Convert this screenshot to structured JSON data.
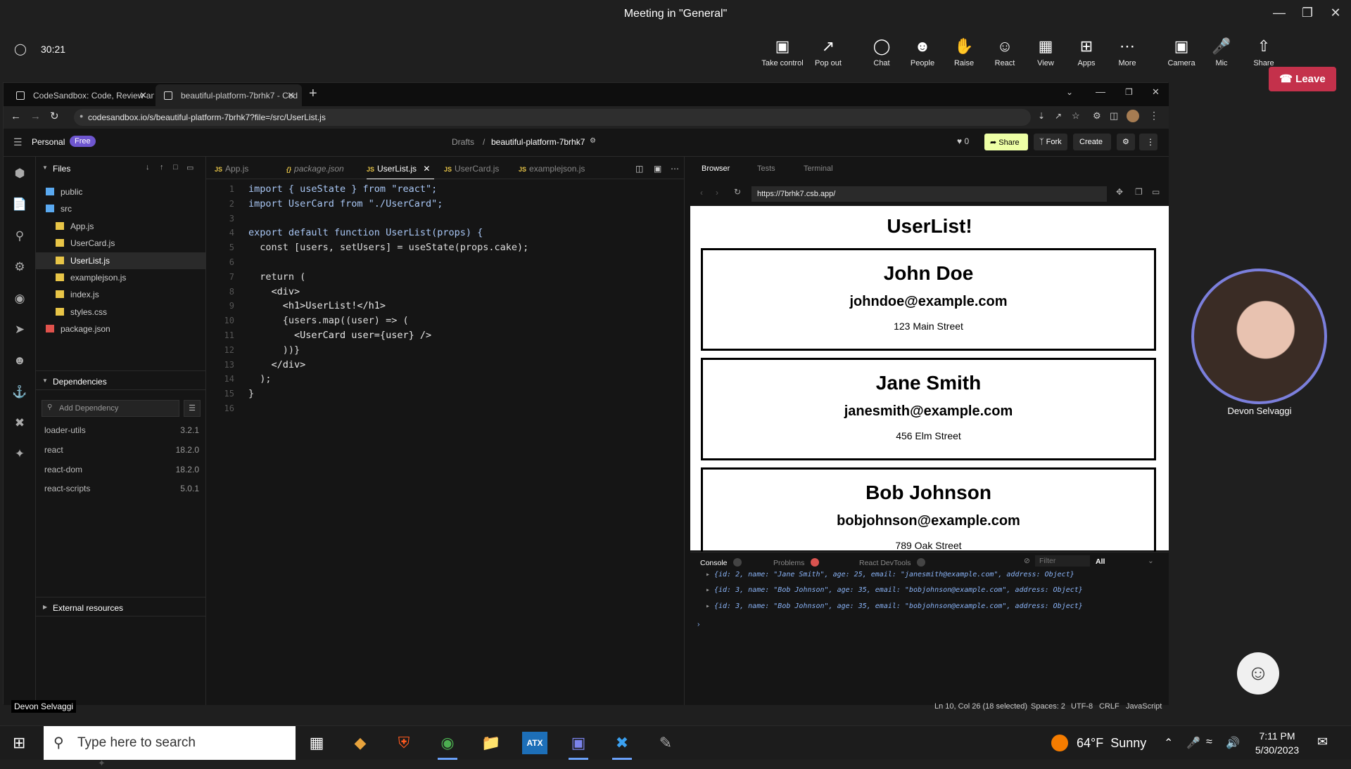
{
  "teams": {
    "title": "Meeting in \"General\"",
    "timer": "30:21",
    "buttons": [
      {
        "icon": "take-control-icon",
        "label": "Take control"
      },
      {
        "icon": "pop-out-icon",
        "label": "Pop out"
      },
      {
        "icon": "chat-icon",
        "label": "Chat"
      },
      {
        "icon": "people-icon",
        "label": "People"
      },
      {
        "icon": "raise-hand-icon",
        "label": "Raise"
      },
      {
        "icon": "react-icon",
        "label": "React"
      },
      {
        "icon": "view-icon",
        "label": "View"
      },
      {
        "icon": "apps-icon",
        "label": "Apps"
      },
      {
        "icon": "more-icon",
        "label": "More"
      },
      {
        "icon": "camera-icon",
        "label": "Camera"
      },
      {
        "icon": "mic-icon",
        "label": "Mic"
      },
      {
        "icon": "share-icon",
        "label": "Share"
      }
    ],
    "leave": "Leave",
    "participant_name": "Devon Selvaggi",
    "presenter_label": "Devon Selvaggi"
  },
  "browser": {
    "tabs": [
      {
        "label": "CodeSandbox: Code, Review and"
      },
      {
        "label": "beautiful-platform-7brhk7 - Cod"
      }
    ],
    "url": "codesandbox.io/s/beautiful-platform-7brhk7?file=/src/UserList.js"
  },
  "csb": {
    "workspace": "Personal",
    "plan": "Free",
    "breadcrumb_parent": "Drafts",
    "breadcrumb_sep": "/",
    "project": "beautiful-platform-7brhk7",
    "likes": "0",
    "share": "Share",
    "fork": "Fork",
    "create": "Create",
    "files_header": "Files",
    "files": [
      {
        "name": "public",
        "type": "folder",
        "indent": 0
      },
      {
        "name": "src",
        "type": "folder",
        "indent": 0
      },
      {
        "name": "App.js",
        "type": "js",
        "indent": 1
      },
      {
        "name": "UserCard.js",
        "type": "js",
        "indent": 1
      },
      {
        "name": "UserList.js",
        "type": "js",
        "indent": 1,
        "active": true
      },
      {
        "name": "examplejson.js",
        "type": "js",
        "indent": 1
      },
      {
        "name": "index.js",
        "type": "js",
        "indent": 1
      },
      {
        "name": "styles.css",
        "type": "css",
        "indent": 1
      },
      {
        "name": "package.json",
        "type": "json",
        "indent": 0
      }
    ],
    "dependencies_header": "Dependencies",
    "add_dependency": "Add Dependency",
    "dependencies": [
      {
        "name": "loader-utils",
        "version": "3.2.1"
      },
      {
        "name": "react",
        "version": "18.2.0"
      },
      {
        "name": "react-dom",
        "version": "18.2.0"
      },
      {
        "name": "react-scripts",
        "version": "5.0.1"
      }
    ],
    "external_resources": "External resources",
    "editor_tabs": [
      "App.js",
      "package.json",
      "UserList.js",
      "UserCard.js",
      "examplejson.js"
    ],
    "code_lines": [
      "import { useState } from \"react\";",
      "import UserCard from \"./UserCard\";",
      "",
      "export default function UserList(props) {",
      "  const [users, setUsers] = useState(props.cake);",
      "",
      "  return (",
      "    <div>",
      "      <h1>UserList!</h1>",
      "      {users.map((user) => (",
      "        <UserCard user={user} />",
      "      ))}",
      "    </div>",
      "  );",
      "}",
      ""
    ],
    "preview_tabs": [
      "Browser",
      "Tests",
      "Terminal"
    ],
    "preview_url": "https://7brhk7.csb.app/",
    "preview_heading": "UserList!",
    "users": [
      {
        "name": "John Doe",
        "email": "johndoe@example.com",
        "address": "123 Main Street"
      },
      {
        "name": "Jane Smith",
        "email": "janesmith@example.com",
        "address": "456 Elm Street"
      },
      {
        "name": "Bob Johnson",
        "email": "bobjohnson@example.com",
        "address": "789 Oak Street"
      }
    ],
    "console_tabs": [
      "Console",
      "Problems",
      "React DevTools"
    ],
    "console_filter": "Filter",
    "console_level": "All",
    "console_logs": [
      "{id: 2, name: \"Jane Smith\", age: 25, email: \"janesmith@example.com\", address: Object}",
      "{id: 3, name: \"Bob Johnson\", age: 35, email: \"bobjohnson@example.com\", address: Object}",
      "{id: 3, name: \"Bob Johnson\", age: 35, email: \"bobjohnson@example.com\", address: Object}"
    ],
    "status": {
      "position": "Ln 10, Col 26 (18 selected)",
      "spaces": "Spaces: 2",
      "encoding": "UTF-8",
      "eol": "CRLF",
      "language": "JavaScript"
    }
  },
  "taskbar": {
    "search_placeholder": "Type here to search",
    "weather": "64°F  Sunny",
    "time": "7:11 PM",
    "date": "5/30/2023"
  }
}
